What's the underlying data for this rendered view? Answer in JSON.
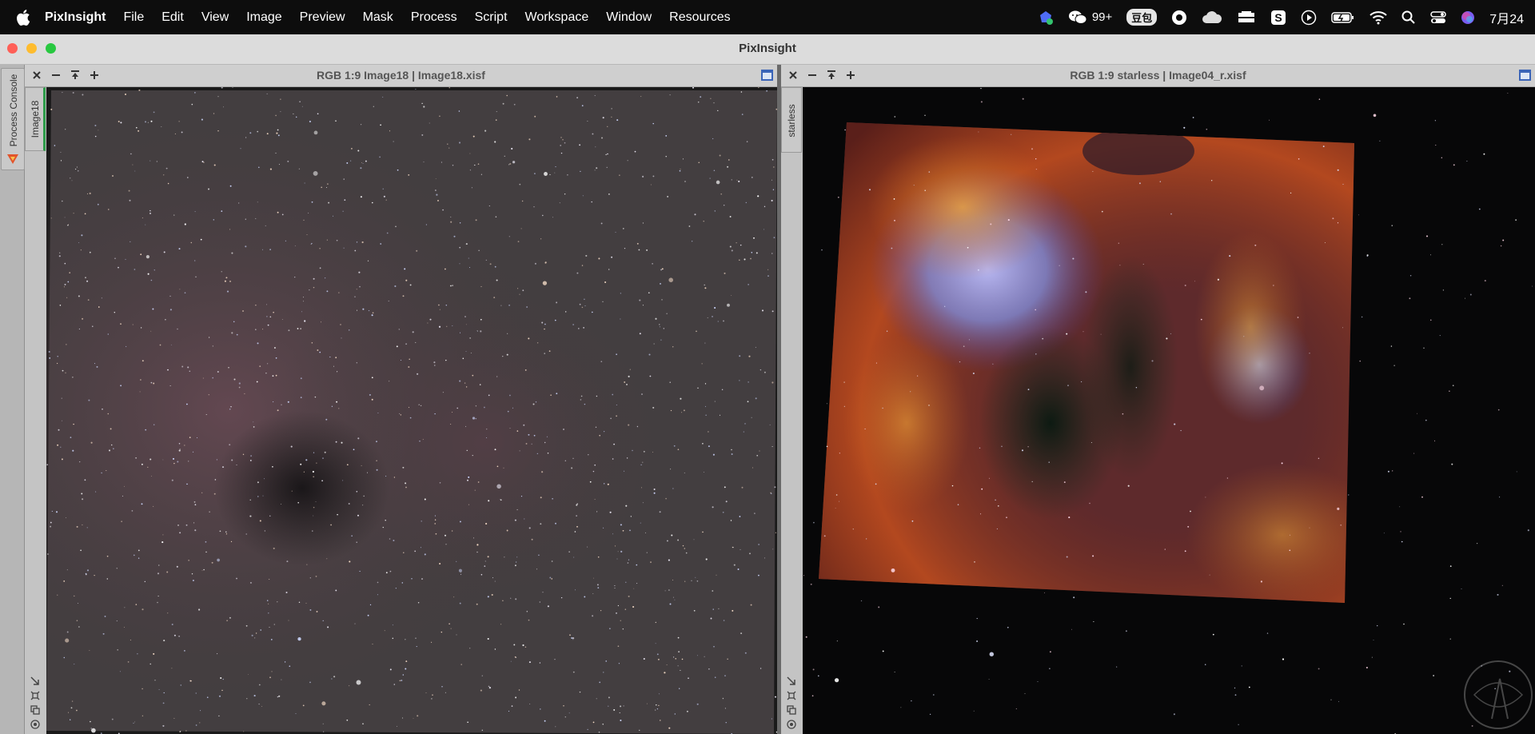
{
  "menubar": {
    "app_name": "PixInsight",
    "menus": [
      "File",
      "Edit",
      "View",
      "Image",
      "Preview",
      "Mask",
      "Process",
      "Script",
      "Workspace",
      "Window",
      "Resources"
    ],
    "status": {
      "wechat_count": "99+",
      "pill_label": "豆包",
      "date": "7月24"
    }
  },
  "window": {
    "title": "PixInsight"
  },
  "left_dock": {
    "process_console_label": "Process Console"
  },
  "image_windows": [
    {
      "title": "RGB 1:9 Image18 | Image18.xisf",
      "tab_label": "Image18"
    },
    {
      "title": "RGB 1:9 starless | Image04_r.xisf",
      "tab_label": "starless"
    }
  ]
}
